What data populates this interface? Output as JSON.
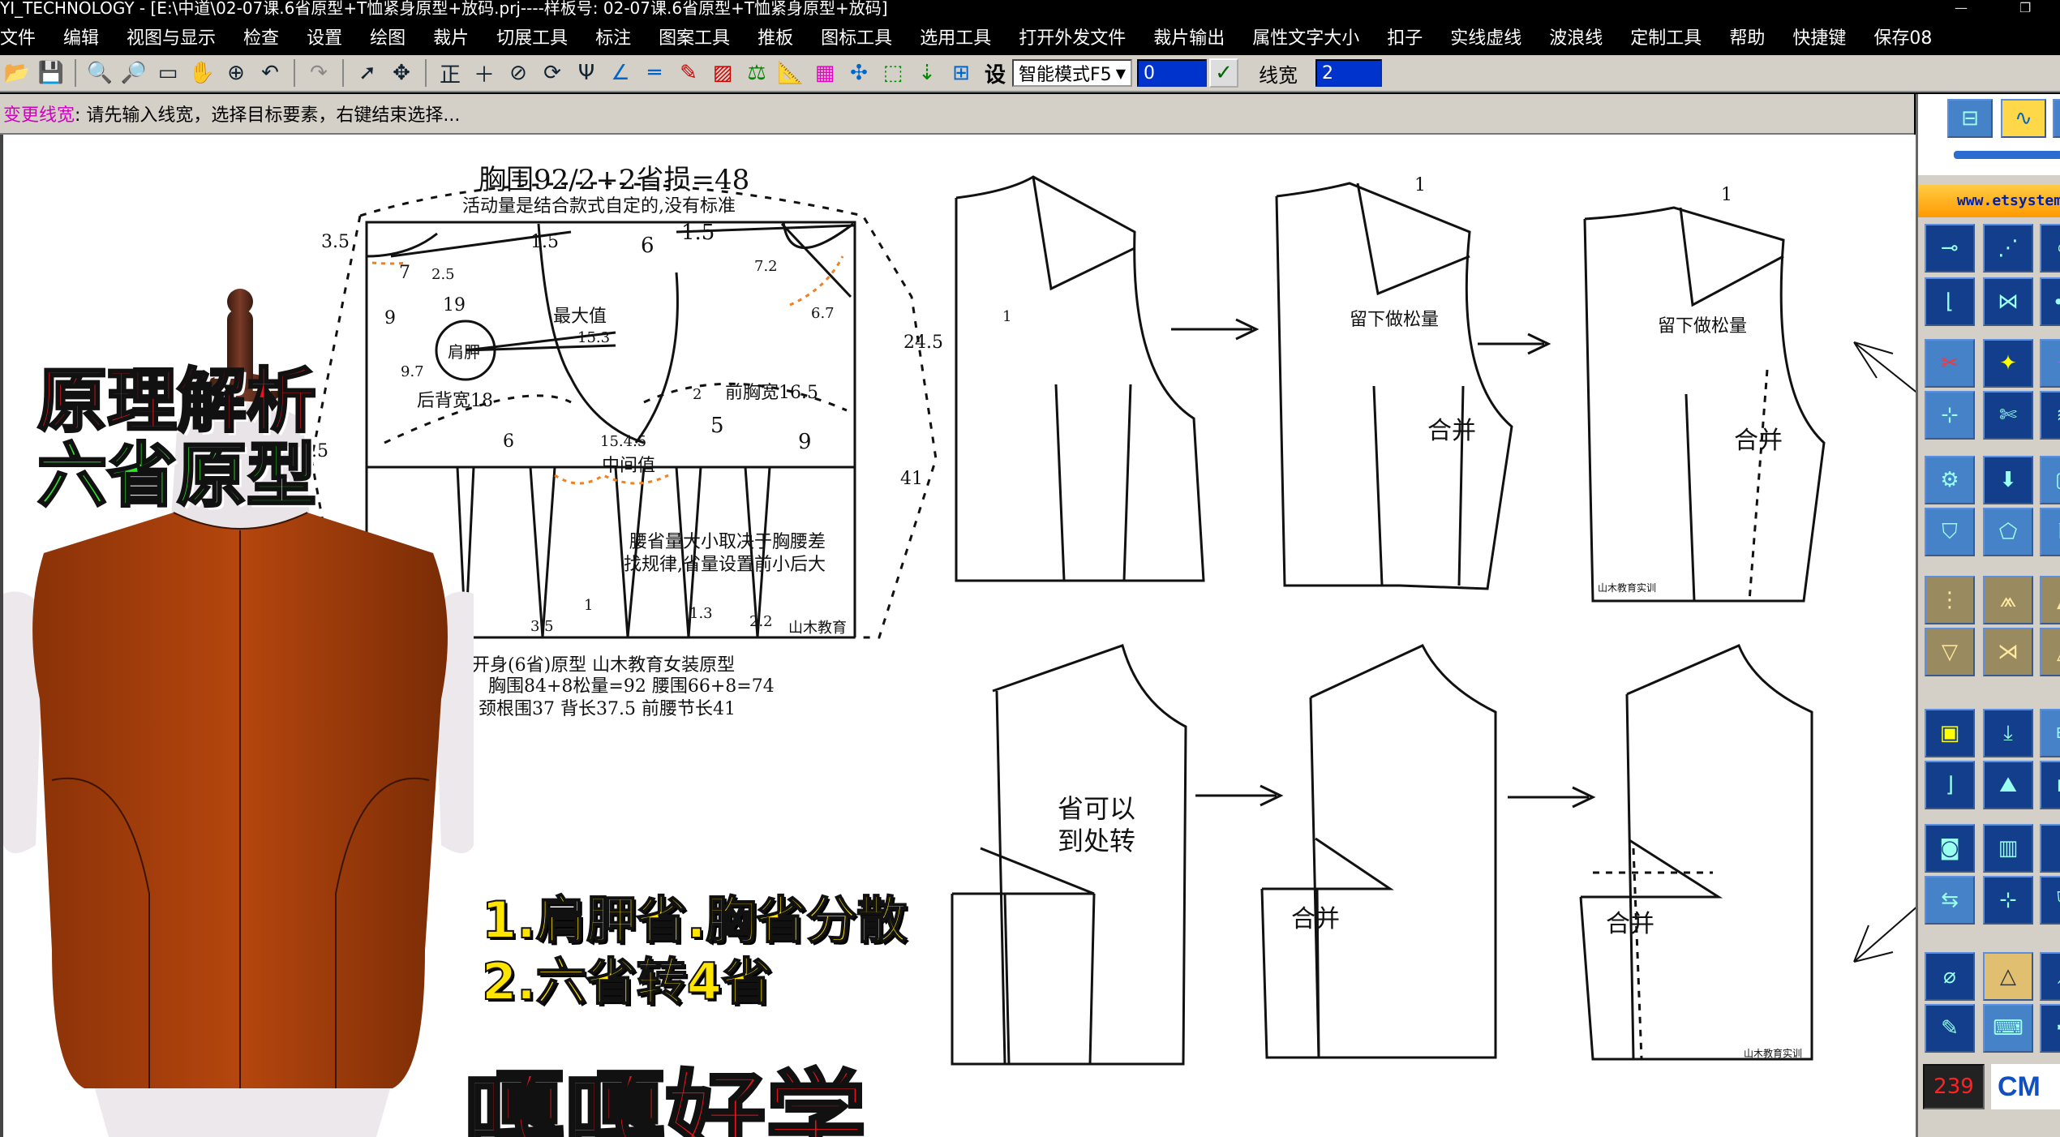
{
  "window": {
    "title": "YI_TECHNOLOGY - [E:\\中道\\02-07课.6省原型+T恤紧身原型+放码.prj----样板号: 02-07课.6省原型+T恤紧身原型+放码]"
  },
  "menubar": {
    "items": [
      "文件",
      "编辑",
      "视图与显示",
      "检查",
      "设置",
      "绘图",
      "裁片",
      "切展工具",
      "标注",
      "图案工具",
      "推板",
      "图标工具",
      "选用工具",
      "打开外发文件",
      "裁片输出",
      "属性文字大小",
      "扣子",
      "实线虚线",
      "波浪线",
      "定制工具",
      "帮助",
      "快捷键",
      "保存08"
    ]
  },
  "toolbar": {
    "text_glyph": "正",
    "set_label": "设",
    "mode_value": "智能模式F5",
    "field1_value": "0",
    "linewidth_label": "线宽",
    "linewidth_value": "2"
  },
  "prompt": {
    "command": "变更线宽",
    "message": ": 请先输入线宽，选择目标要素，右键结束选择..."
  },
  "overlay": {
    "title_red": "原理解析",
    "title_green": "六省原型",
    "point1": "1.肩胛省.胸省分散",
    "point2": "2.六省转4省",
    "slogan": "嘎嘎好学"
  },
  "pattern": {
    "header": "胸围92/2+2省损=48",
    "subheader": "活动量是结合款式自定的,没有标准",
    "labels": {
      "shoulder_blade": "肩胛",
      "max_value": "最大值",
      "back_width": "后背宽18",
      "front_chest_width": "前胸宽16.5",
      "mid_value": "中间值",
      "waist_note1": "腰省量大小取决于胸腰差",
      "waist_note2": "找规律,省量设置前小后大",
      "brand": "山木教育",
      "caption1": "六开身(6省)原型 山木教育女装原型",
      "caption2": "胸围84+8松量=92   腰围66+8=74",
      "caption3": "颈根围37   背长37.5   前腰节长41"
    },
    "dims": [
      "3.5",
      "7",
      "2.5",
      "1.5",
      "19",
      "9",
      "9.7",
      "6",
      "1.5",
      "7.2",
      "6.7",
      "15.3",
      "24.5",
      "37.5",
      "6",
      "15.4.5",
      "5",
      "9",
      "41",
      "1",
      "3.5",
      "1",
      "1.3",
      "2.2",
      "2",
      "1"
    ],
    "pieces": {
      "keep_ease": "留下做松量",
      "merge": "合并",
      "dart_transfer1": "省可以",
      "dart_transfer2": "到处转",
      "mark_one": "1",
      "brand_small": "山木教育实训"
    }
  },
  "rightpanel": {
    "url": "www.etsystem",
    "counter": "239",
    "logo": "CM"
  }
}
